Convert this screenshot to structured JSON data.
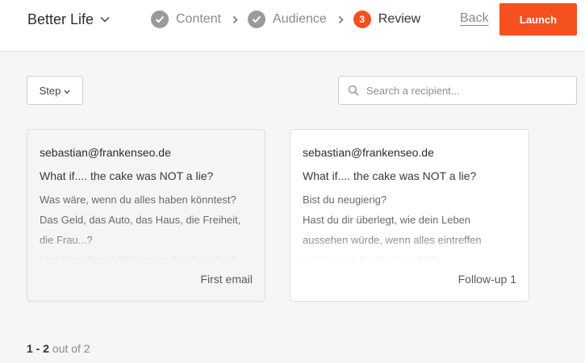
{
  "header": {
    "campaign_name": "Better Life",
    "steps": [
      {
        "number": "",
        "label": "Content",
        "state": "done"
      },
      {
        "number": "",
        "label": "Audience",
        "state": "done"
      },
      {
        "number": "3",
        "label": "Review",
        "state": "current"
      }
    ],
    "back_label": "Back",
    "launch_label": "Launch"
  },
  "toolbar": {
    "step_filter_label": "Step",
    "search_placeholder": "Search a recipient..."
  },
  "cards": [
    {
      "email": "sebastian@frankenseo.de",
      "subject": "What if.... the cake was NOT a lie?",
      "body_lines": [
        "Was wäre, wenn du alles haben könntest?",
        "Das Geld, das Auto, das Haus, die Freiheit,",
        "die Frau...?",
        "Und einer Beschäftigung nachgehst, die du"
      ],
      "step_label": "First email"
    },
    {
      "email": "sebastian@frankenseo.de",
      "subject": "What if.... the cake was NOT a lie?",
      "body_lines": [
        "Bist du neugierig?",
        "Hast du dir überlegt, wie dein Leben",
        "aussehen würde, wenn alles eintreffen",
        "würde, was du dir wünschst?"
      ],
      "step_label": "Follow-up 1"
    }
  ],
  "pagination": {
    "range": "1 - 2",
    "total_text": "out of 2"
  },
  "colors": {
    "accent": "#f4511e",
    "step_done": "#9a9a9a"
  }
}
